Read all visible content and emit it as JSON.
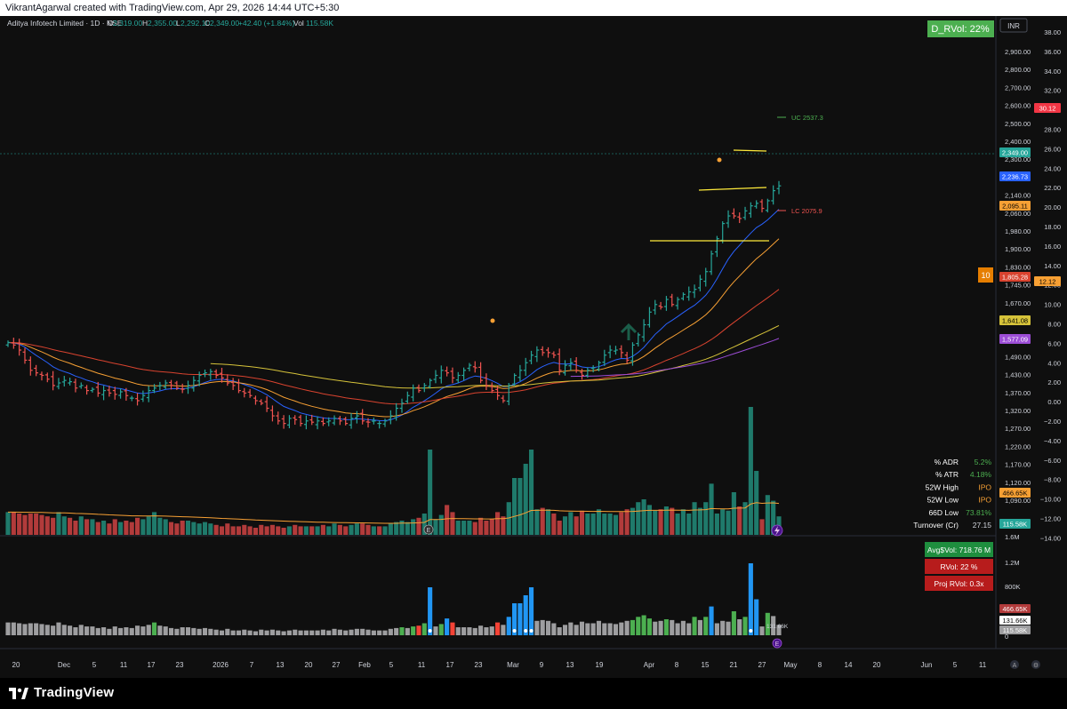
{
  "header": {
    "attribution": "VikrantAgarwal created with TradingView.com, Apr 29, 2026 14:44 UTC+5:30"
  },
  "legend": {
    "symbol": "Aditya Infotech Limited · 1D · NSE",
    "o_label": "O",
    "o_value": "2,319.00",
    "h_label": "H",
    "h_value": "2,355.00",
    "l_label": "L",
    "l_value": "2,292.10",
    "c_label": "C",
    "c_value": "2,349.00",
    "change": "+42.40 (+1.84%)",
    "vol_label": "Vol",
    "vol_value": "115.58K"
  },
  "currency": "INR",
  "drvol_badge": "D_RVol: 22%",
  "ten_badge": "10",
  "colors": {
    "up": "#26a69a",
    "down": "#ef5350",
    "vol_up": "#1f7a6b",
    "vol_down": "#b23b3b",
    "ema_blue": "#2962ff",
    "ema_orange": "#f7a034",
    "ema_red": "#d9432f",
    "ema_yellow": "#d6c33a",
    "ema_purple": "#9c4dd6",
    "rvol_blue": "#2196f3",
    "rvol_green": "#4caf50",
    "rvol_red": "#f44336",
    "rvol_gray": "#9e9ea0"
  },
  "right_axis": {
    "price_labels": [
      "2,900.00",
      "2,800.00",
      "2,700.00",
      "2,600.00",
      "2,500.00",
      "2,400.00",
      "2,300.00",
      "2,220.00",
      "2,140.00",
      "2,060.00",
      "1,980.00",
      "1,900.00",
      "1,830.00",
      "1,745.00",
      "1,670.00",
      "1,610.00",
      "1,550.00",
      "1,490.00",
      "1,430.00",
      "1,370.00",
      "1,320.00",
      "1,270.00",
      "1,220.00",
      "1,170.00",
      "1,120.00",
      "1,090.00"
    ],
    "percent_labels": [
      "38.00",
      "36.00",
      "34.00",
      "32.00",
      "30.00",
      "28.00",
      "26.00",
      "24.00",
      "22.00",
      "20.00",
      "18.00",
      "16.00",
      "14.00",
      "12.00",
      "10.00",
      "8.00",
      "6.00",
      "4.00",
      "2.00",
      "0.00",
      "−2.00",
      "−4.00",
      "−6.00",
      "−8.00",
      "−10.00",
      "−12.00",
      "−14.00"
    ],
    "tags": [
      {
        "text": "30.12",
        "color": "#f23645"
      },
      {
        "text": "2,349.00",
        "color": "#26a69a"
      },
      {
        "text": "2,236.73",
        "color": "#2962ff"
      },
      {
        "text": "2,095.11",
        "color": "#f7a034"
      },
      {
        "text": "1,805.28",
        "color": "#d9432f"
      },
      {
        "text": "12.12",
        "color": "#f7a034"
      },
      {
        "text": "1,641.08",
        "color": "#d6c33a"
      },
      {
        "text": "1,577.09",
        "color": "#9c4dd6"
      },
      {
        "text": "466.65K",
        "color": "#f7a034"
      },
      {
        "text": "115.58K",
        "color": "#26a69a"
      }
    ],
    "rvol_axis": [
      "1.2M",
      "800K"
    ],
    "rvol_tags": [
      {
        "text": "466.65K",
        "color": "#b23b3b"
      },
      {
        "text": "131.66K",
        "color": "#ffffff"
      },
      {
        "text": "115.58K",
        "color": "#9e9ea0"
      }
    ],
    "rvol_top": "1.6M",
    "rvol_zero": "0",
    "rvol_inline": "131.66K"
  },
  "annotations": {
    "uc": "UC 2537.3",
    "lc": "LC 2075.9"
  },
  "stats": [
    {
      "label": "% ADR",
      "value": "5.2%",
      "color": "#4caf50"
    },
    {
      "label": "% ATR",
      "value": "4.18%",
      "color": "#4caf50"
    },
    {
      "label": "52W High",
      "value": "IPO",
      "color": "#f7a034"
    },
    {
      "label": "52W Low",
      "value": "IPO",
      "color": "#f7a034"
    },
    {
      "label": "66D Low",
      "value": "73.81%",
      "color": "#4caf50"
    },
    {
      "label": "Turnover (Cr)",
      "value": "27.15",
      "color": "#d1d4dc"
    }
  ],
  "rvol_panel": {
    "avg": "Avg$Vol: 718.76 M",
    "rvol": "RVol: 22 %",
    "proj": "Proj RVol: 0.3x"
  },
  "x_axis": {
    "labels": [
      "20",
      "Dec",
      "5",
      "11",
      "17",
      "23",
      "2026",
      "7",
      "13",
      "20",
      "27",
      "Feb",
      "5",
      "11",
      "17",
      "23",
      "Mar",
      "9",
      "13",
      "19",
      "Apr",
      "8",
      "15",
      "21",
      "27",
      "May",
      "8",
      "14",
      "20",
      "Jun",
      "5",
      "11"
    ]
  },
  "footer": {
    "brand": "TradingView"
  },
  "chart_data": {
    "type": "candlestick",
    "title": "",
    "x_labels": [
      "20",
      "Dec",
      "5",
      "11",
      "17",
      "23",
      "2026",
      "7",
      "13",
      "20",
      "27",
      "Feb",
      "5",
      "11",
      "17",
      "23",
      "Mar",
      "9",
      "13",
      "19",
      "Apr",
      "8",
      "15",
      "21",
      "27",
      "May",
      "8",
      "14",
      "20",
      "Jun",
      "5",
      "11"
    ],
    "close_series": [
      1730,
      1720,
      1700,
      1660,
      1620,
      1610,
      1600,
      1585,
      1560,
      1570,
      1580,
      1575,
      1550,
      1560,
      1540,
      1545,
      1530,
      1540,
      1530,
      1525,
      1535,
      1520,
      1510,
      1500,
      1520,
      1540,
      1550,
      1560,
      1570,
      1560,
      1550,
      1545,
      1560,
      1580,
      1600,
      1610,
      1615,
      1600,
      1590,
      1570,
      1560,
      1540,
      1530,
      1520,
      1500,
      1490,
      1470,
      1440,
      1420,
      1410,
      1430,
      1425,
      1410,
      1420,
      1415,
      1420,
      1410,
      1420,
      1430,
      1420,
      1410,
      1430,
      1440,
      1420,
      1415,
      1420,
      1410,
      1420,
      1440,
      1470,
      1490,
      1520,
      1550,
      1540,
      1560,
      1580,
      1600,
      1620,
      1610,
      1590,
      1600,
      1620,
      1640,
      1630,
      1580,
      1560,
      1540,
      1520,
      1500,
      1560,
      1600,
      1620,
      1650,
      1680,
      1700,
      1690,
      1690,
      1680,
      1620,
      1640,
      1650,
      1620,
      1600,
      1620,
      1630,
      1650,
      1680,
      1700,
      1700,
      1690,
      1660,
      1720,
      1760,
      1800,
      1850,
      1880,
      1870,
      1900,
      1880,
      1900,
      1920,
      1930,
      1940,
      1980,
      2010,
      2080,
      2140,
      2200,
      2230,
      2230,
      2220,
      2250,
      2270,
      2280,
      2260,
      2290,
      2330,
      2349
    ],
    "volume_series_k": [
      160,
      160,
      150,
      140,
      150,
      150,
      140,
      130,
      120,
      160,
      130,
      120,
      100,
      130,
      110,
      110,
      90,
      100,
      80,
      110,
      90,
      100,
      90,
      120,
      110,
      130,
      160,
      120,
      110,
      90,
      80,
      100,
      100,
      90,
      80,
      90,
      80,
      70,
      60,
      80,
      60,
      60,
      70,
      60,
      50,
      70,
      60,
      70,
      60,
      50,
      60,
      70,
      60,
      60,
      60,
      60,
      70,
      60,
      80,
      70,
      60,
      70,
      80,
      80,
      70,
      60,
      60,
      60,
      80,
      90,
      100,
      90,
      110,
      120,
      150,
      600,
      110,
      140,
      210,
      160,
      100,
      100,
      100,
      90,
      120,
      100,
      110,
      160,
      130,
      230,
      400,
      400,
      500,
      600,
      180,
      190,
      180,
      150,
      100,
      130,
      160,
      130,
      170,
      150,
      150,
      180,
      150,
      150,
      140,
      160,
      180,
      190,
      230,
      250,
      210,
      170,
      180,
      200,
      190,
      150,
      180,
      150,
      230,
      190,
      230,
      360,
      150,
      180,
      170,
      300,
      200,
      230,
      900,
      450,
      110,
      280,
      240,
      130
    ],
    "price_ylim": [
      1370,
      2950
    ],
    "last_close": 2349.0,
    "drvol_percent": 22
  }
}
